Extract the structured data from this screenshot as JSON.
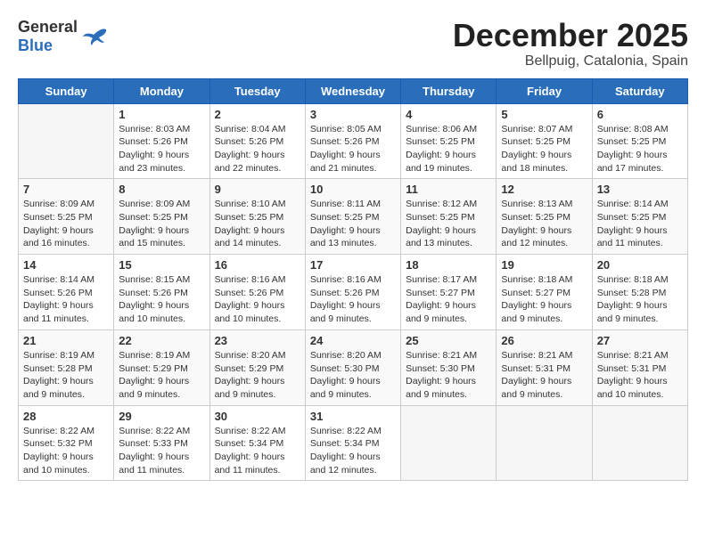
{
  "logo": {
    "text_general": "General",
    "text_blue": "Blue"
  },
  "header": {
    "month_year": "December 2025",
    "location": "Bellpuig, Catalonia, Spain"
  },
  "weekdays": [
    "Sunday",
    "Monday",
    "Tuesday",
    "Wednesday",
    "Thursday",
    "Friday",
    "Saturday"
  ],
  "weeks": [
    [
      {
        "day": "",
        "sunrise": "",
        "sunset": "",
        "daylight": ""
      },
      {
        "day": "1",
        "sunrise": "Sunrise: 8:03 AM",
        "sunset": "Sunset: 5:26 PM",
        "daylight": "Daylight: 9 hours and 23 minutes."
      },
      {
        "day": "2",
        "sunrise": "Sunrise: 8:04 AM",
        "sunset": "Sunset: 5:26 PM",
        "daylight": "Daylight: 9 hours and 22 minutes."
      },
      {
        "day": "3",
        "sunrise": "Sunrise: 8:05 AM",
        "sunset": "Sunset: 5:26 PM",
        "daylight": "Daylight: 9 hours and 21 minutes."
      },
      {
        "day": "4",
        "sunrise": "Sunrise: 8:06 AM",
        "sunset": "Sunset: 5:25 PM",
        "daylight": "Daylight: 9 hours and 19 minutes."
      },
      {
        "day": "5",
        "sunrise": "Sunrise: 8:07 AM",
        "sunset": "Sunset: 5:25 PM",
        "daylight": "Daylight: 9 hours and 18 minutes."
      },
      {
        "day": "6",
        "sunrise": "Sunrise: 8:08 AM",
        "sunset": "Sunset: 5:25 PM",
        "daylight": "Daylight: 9 hours and 17 minutes."
      }
    ],
    [
      {
        "day": "7",
        "sunrise": "Sunrise: 8:09 AM",
        "sunset": "Sunset: 5:25 PM",
        "daylight": "Daylight: 9 hours and 16 minutes."
      },
      {
        "day": "8",
        "sunrise": "Sunrise: 8:09 AM",
        "sunset": "Sunset: 5:25 PM",
        "daylight": "Daylight: 9 hours and 15 minutes."
      },
      {
        "day": "9",
        "sunrise": "Sunrise: 8:10 AM",
        "sunset": "Sunset: 5:25 PM",
        "daylight": "Daylight: 9 hours and 14 minutes."
      },
      {
        "day": "10",
        "sunrise": "Sunrise: 8:11 AM",
        "sunset": "Sunset: 5:25 PM",
        "daylight": "Daylight: 9 hours and 13 minutes."
      },
      {
        "day": "11",
        "sunrise": "Sunrise: 8:12 AM",
        "sunset": "Sunset: 5:25 PM",
        "daylight": "Daylight: 9 hours and 13 minutes."
      },
      {
        "day": "12",
        "sunrise": "Sunrise: 8:13 AM",
        "sunset": "Sunset: 5:25 PM",
        "daylight": "Daylight: 9 hours and 12 minutes."
      },
      {
        "day": "13",
        "sunrise": "Sunrise: 8:14 AM",
        "sunset": "Sunset: 5:25 PM",
        "daylight": "Daylight: 9 hours and 11 minutes."
      }
    ],
    [
      {
        "day": "14",
        "sunrise": "Sunrise: 8:14 AM",
        "sunset": "Sunset: 5:26 PM",
        "daylight": "Daylight: 9 hours and 11 minutes."
      },
      {
        "day": "15",
        "sunrise": "Sunrise: 8:15 AM",
        "sunset": "Sunset: 5:26 PM",
        "daylight": "Daylight: 9 hours and 10 minutes."
      },
      {
        "day": "16",
        "sunrise": "Sunrise: 8:16 AM",
        "sunset": "Sunset: 5:26 PM",
        "daylight": "Daylight: 9 hours and 10 minutes."
      },
      {
        "day": "17",
        "sunrise": "Sunrise: 8:16 AM",
        "sunset": "Sunset: 5:26 PM",
        "daylight": "Daylight: 9 hours and 9 minutes."
      },
      {
        "day": "18",
        "sunrise": "Sunrise: 8:17 AM",
        "sunset": "Sunset: 5:27 PM",
        "daylight": "Daylight: 9 hours and 9 minutes."
      },
      {
        "day": "19",
        "sunrise": "Sunrise: 8:18 AM",
        "sunset": "Sunset: 5:27 PM",
        "daylight": "Daylight: 9 hours and 9 minutes."
      },
      {
        "day": "20",
        "sunrise": "Sunrise: 8:18 AM",
        "sunset": "Sunset: 5:28 PM",
        "daylight": "Daylight: 9 hours and 9 minutes."
      }
    ],
    [
      {
        "day": "21",
        "sunrise": "Sunrise: 8:19 AM",
        "sunset": "Sunset: 5:28 PM",
        "daylight": "Daylight: 9 hours and 9 minutes."
      },
      {
        "day": "22",
        "sunrise": "Sunrise: 8:19 AM",
        "sunset": "Sunset: 5:29 PM",
        "daylight": "Daylight: 9 hours and 9 minutes."
      },
      {
        "day": "23",
        "sunrise": "Sunrise: 8:20 AM",
        "sunset": "Sunset: 5:29 PM",
        "daylight": "Daylight: 9 hours and 9 minutes."
      },
      {
        "day": "24",
        "sunrise": "Sunrise: 8:20 AM",
        "sunset": "Sunset: 5:30 PM",
        "daylight": "Daylight: 9 hours and 9 minutes."
      },
      {
        "day": "25",
        "sunrise": "Sunrise: 8:21 AM",
        "sunset": "Sunset: 5:30 PM",
        "daylight": "Daylight: 9 hours and 9 minutes."
      },
      {
        "day": "26",
        "sunrise": "Sunrise: 8:21 AM",
        "sunset": "Sunset: 5:31 PM",
        "daylight": "Daylight: 9 hours and 9 minutes."
      },
      {
        "day": "27",
        "sunrise": "Sunrise: 8:21 AM",
        "sunset": "Sunset: 5:31 PM",
        "daylight": "Daylight: 9 hours and 10 minutes."
      }
    ],
    [
      {
        "day": "28",
        "sunrise": "Sunrise: 8:22 AM",
        "sunset": "Sunset: 5:32 PM",
        "daylight": "Daylight: 9 hours and 10 minutes."
      },
      {
        "day": "29",
        "sunrise": "Sunrise: 8:22 AM",
        "sunset": "Sunset: 5:33 PM",
        "daylight": "Daylight: 9 hours and 11 minutes."
      },
      {
        "day": "30",
        "sunrise": "Sunrise: 8:22 AM",
        "sunset": "Sunset: 5:34 PM",
        "daylight": "Daylight: 9 hours and 11 minutes."
      },
      {
        "day": "31",
        "sunrise": "Sunrise: 8:22 AM",
        "sunset": "Sunset: 5:34 PM",
        "daylight": "Daylight: 9 hours and 12 minutes."
      },
      {
        "day": "",
        "sunrise": "",
        "sunset": "",
        "daylight": ""
      },
      {
        "day": "",
        "sunrise": "",
        "sunset": "",
        "daylight": ""
      },
      {
        "day": "",
        "sunrise": "",
        "sunset": "",
        "daylight": ""
      }
    ]
  ]
}
